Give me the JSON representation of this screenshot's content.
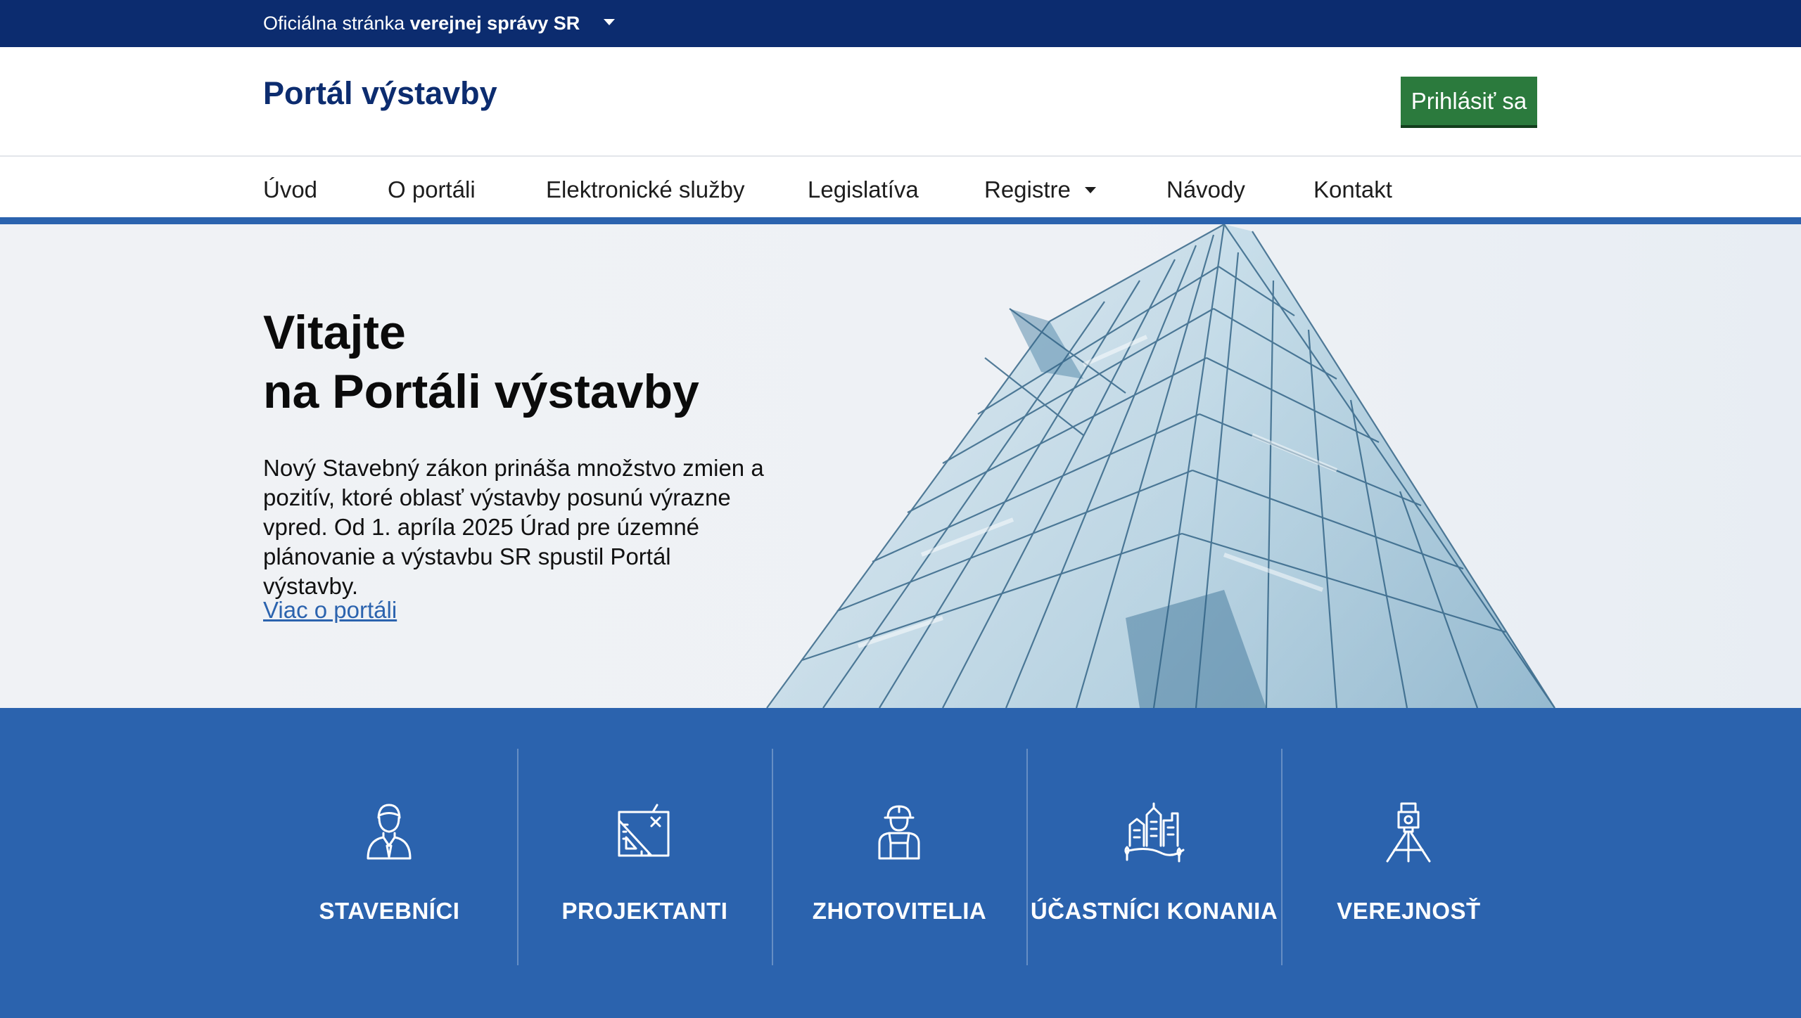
{
  "topbar": {
    "prefix": "Oficiálna stránka",
    "bold": "verejnej správy SR"
  },
  "header": {
    "site_title": "Portál výstavby",
    "login_label": "Prihlásiť sa"
  },
  "nav": {
    "items": [
      {
        "label": "Úvod"
      },
      {
        "label": "O portáli"
      },
      {
        "label": "Elektronické služby"
      },
      {
        "label": "Legislatíva"
      },
      {
        "label": "Registre"
      },
      {
        "label": "Návody"
      },
      {
        "label": "Kontakt"
      }
    ]
  },
  "hero": {
    "title_line1": "Vitajte",
    "title_line2": "na Portáli výstavby",
    "description": "Nový Stavebný zákon prináša množstvo zmien a pozitív, ktoré oblasť výstavby posunú výrazne vpred. Od 1. apríla 2025 Úrad pre územné plánovanie a výstavbu SR spustil Portál výstavby.",
    "link_label": "Viac o portáli"
  },
  "roles": [
    {
      "label": "STAVEBNÍCI",
      "icon": "builder-person-icon"
    },
    {
      "label": "PROJEKTANTI",
      "icon": "blueprint-ruler-icon"
    },
    {
      "label": "ZHOTOVITELIA",
      "icon": "construction-worker-icon"
    },
    {
      "label": "ÚČASTNÍCI KONANIA",
      "icon": "town-buildings-icon"
    },
    {
      "label": "VEREJNOSŤ",
      "icon": "surveyor-tripod-icon"
    }
  ],
  "colors": {
    "topbar": "#0c2c6f",
    "brand_blue": "#2b63ae",
    "login_green": "#2b7a3d",
    "title_blue": "#0c2c6f"
  }
}
